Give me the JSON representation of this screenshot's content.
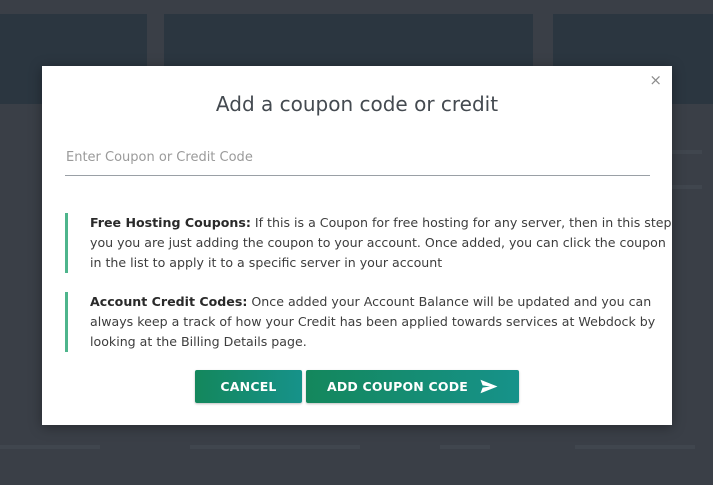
{
  "modal": {
    "title": "Add a coupon code or credit",
    "close_label": "×",
    "input": {
      "placeholder": "Enter Coupon or Credit Code",
      "value": ""
    },
    "notes": [
      {
        "heading": "Free Hosting Coupons:",
        "text": " If this is a Coupon for free hosting for any server, then in this step you you are just adding the coupon to your account. Once added, you can click the coupon in the list to apply it to a specific server in your account"
      },
      {
        "heading": "Account Credit Codes:",
        "text": " Once added your Account Balance will be updated and you can always keep a track of how your Credit has been applied towards services at Webdock by looking at the Billing Details page."
      }
    ],
    "buttons": {
      "cancel_label": "CANCEL",
      "add_label": "ADD COUPON CODE",
      "add_icon": "send-icon"
    }
  },
  "colors": {
    "accent": "#4eb58c",
    "button_start": "#14875c",
    "button_end": "#16928a",
    "overlay": "#3a3f47"
  }
}
